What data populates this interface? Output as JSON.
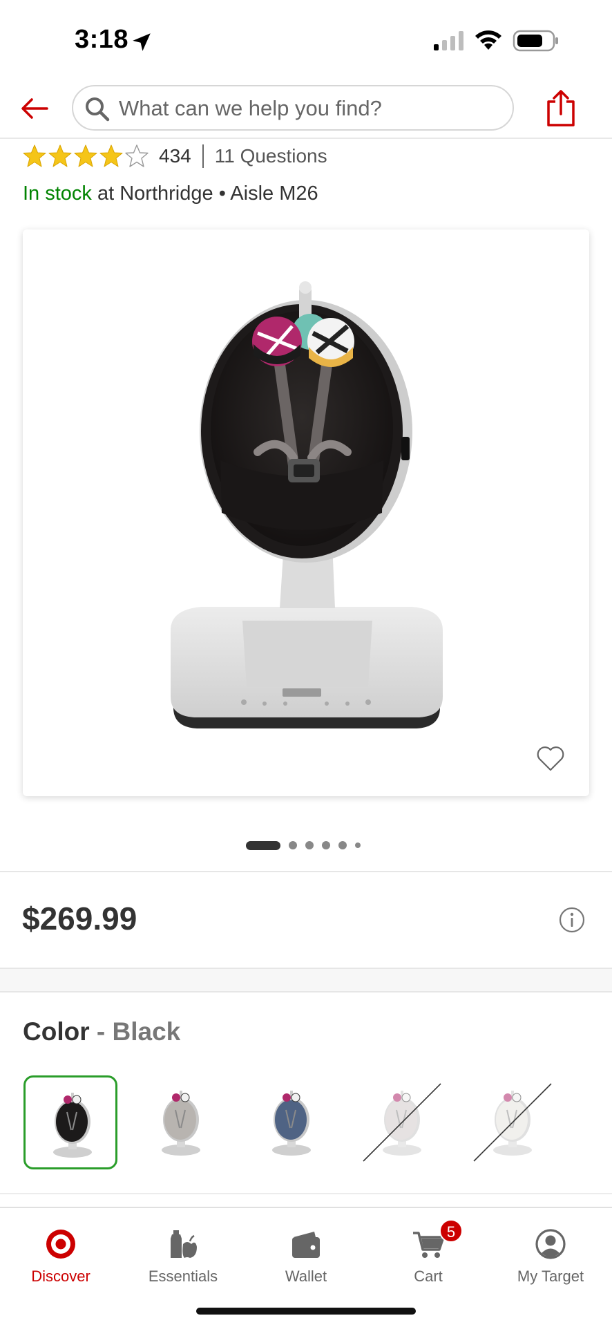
{
  "status_bar": {
    "time": "3:18"
  },
  "header": {
    "search_placeholder": "What can we help you find?"
  },
  "rating": {
    "stars": 4,
    "max_stars": 5,
    "count": "434",
    "questions": "11 Questions"
  },
  "stock": {
    "status": "In stock",
    "location_text": " at Northridge • Aisle M26"
  },
  "gallery": {
    "image_count": 6,
    "active_index": 0
  },
  "price": {
    "amount": "$269.99"
  },
  "color": {
    "label": "Color",
    "separator": " - ",
    "selected": "Black",
    "swatches": [
      {
        "color": "#1c1a1a",
        "available": true,
        "selected": true
      },
      {
        "color": "#b8b4b0",
        "available": true,
        "selected": false
      },
      {
        "color": "#4f6384",
        "available": true,
        "selected": false
      },
      {
        "color": "#d2cccc",
        "available": false,
        "selected": false
      },
      {
        "color": "#e6e4e0",
        "available": false,
        "selected": false
      }
    ]
  },
  "bottom_nav": {
    "items": [
      {
        "label": "Discover",
        "active": true
      },
      {
        "label": "Essentials",
        "active": false
      },
      {
        "label": "Wallet",
        "active": false
      },
      {
        "label": "Cart",
        "active": false,
        "badge": "5"
      },
      {
        "label": "My Target",
        "active": false
      }
    ]
  },
  "colors": {
    "brand_red": "#cc0000",
    "stock_green": "#008300",
    "selected_border": "#2a9d2a"
  }
}
